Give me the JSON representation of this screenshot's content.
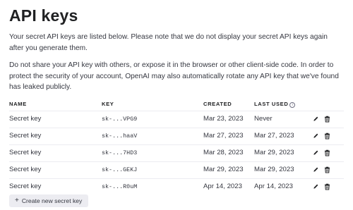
{
  "page": {
    "title": "API keys",
    "description_1": "Your secret API keys are listed below. Please note that we do not display your secret API keys again after you generate them.",
    "description_2": "Do not share your API key with others, or expose it in the browser or other client-side code. In order to protect the security of your account, OpenAI may also automatically rotate any API key that we've found has leaked publicly."
  },
  "table": {
    "headers": {
      "name": "NAME",
      "key": "KEY",
      "created": "CREATED",
      "last_used": "LAST USED"
    },
    "rows": [
      {
        "name": "Secret key",
        "key": "sk-...VPG9",
        "created": "Mar 23, 2023",
        "last_used": "Never"
      },
      {
        "name": "Secret key",
        "key": "sk-...haaV",
        "created": "Mar 27, 2023",
        "last_used": "Mar 27, 2023"
      },
      {
        "name": "Secret key",
        "key": "sk-...7HD3",
        "created": "Mar 28, 2023",
        "last_used": "Mar 29, 2023"
      },
      {
        "name": "Secret key",
        "key": "sk-...GEKJ",
        "created": "Mar 29, 2023",
        "last_used": "Mar 29, 2023"
      },
      {
        "name": "Secret key",
        "key": "sk-...R0uM",
        "created": "Apr 14, 2023",
        "last_used": "Apr 14, 2023"
      }
    ]
  },
  "actions": {
    "create_label": "Create new secret key"
  },
  "icons": {
    "edit": "pencil-icon",
    "delete": "trash-icon",
    "info": "info-icon",
    "add": "plus-icon"
  }
}
